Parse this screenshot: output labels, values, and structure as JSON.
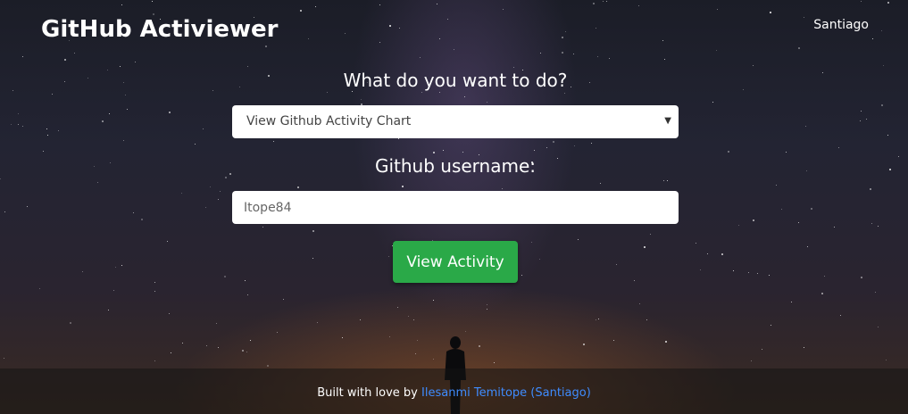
{
  "header": {
    "brand": "GitHub Activiewer",
    "user": "Santiago"
  },
  "form": {
    "question": "What do you want to do?",
    "action_select": {
      "selected": "View Github Activity Chart"
    },
    "username_label": "Github username:",
    "username_input": {
      "value": "Itope84"
    },
    "submit_label": "View Activity"
  },
  "footer": {
    "text": "Built with love by",
    "author_link": "Ilesanmi Temitope (Santiago)"
  },
  "colors": {
    "button": "#2aa948",
    "link": "#3f8cff",
    "text": "#ffffff"
  }
}
